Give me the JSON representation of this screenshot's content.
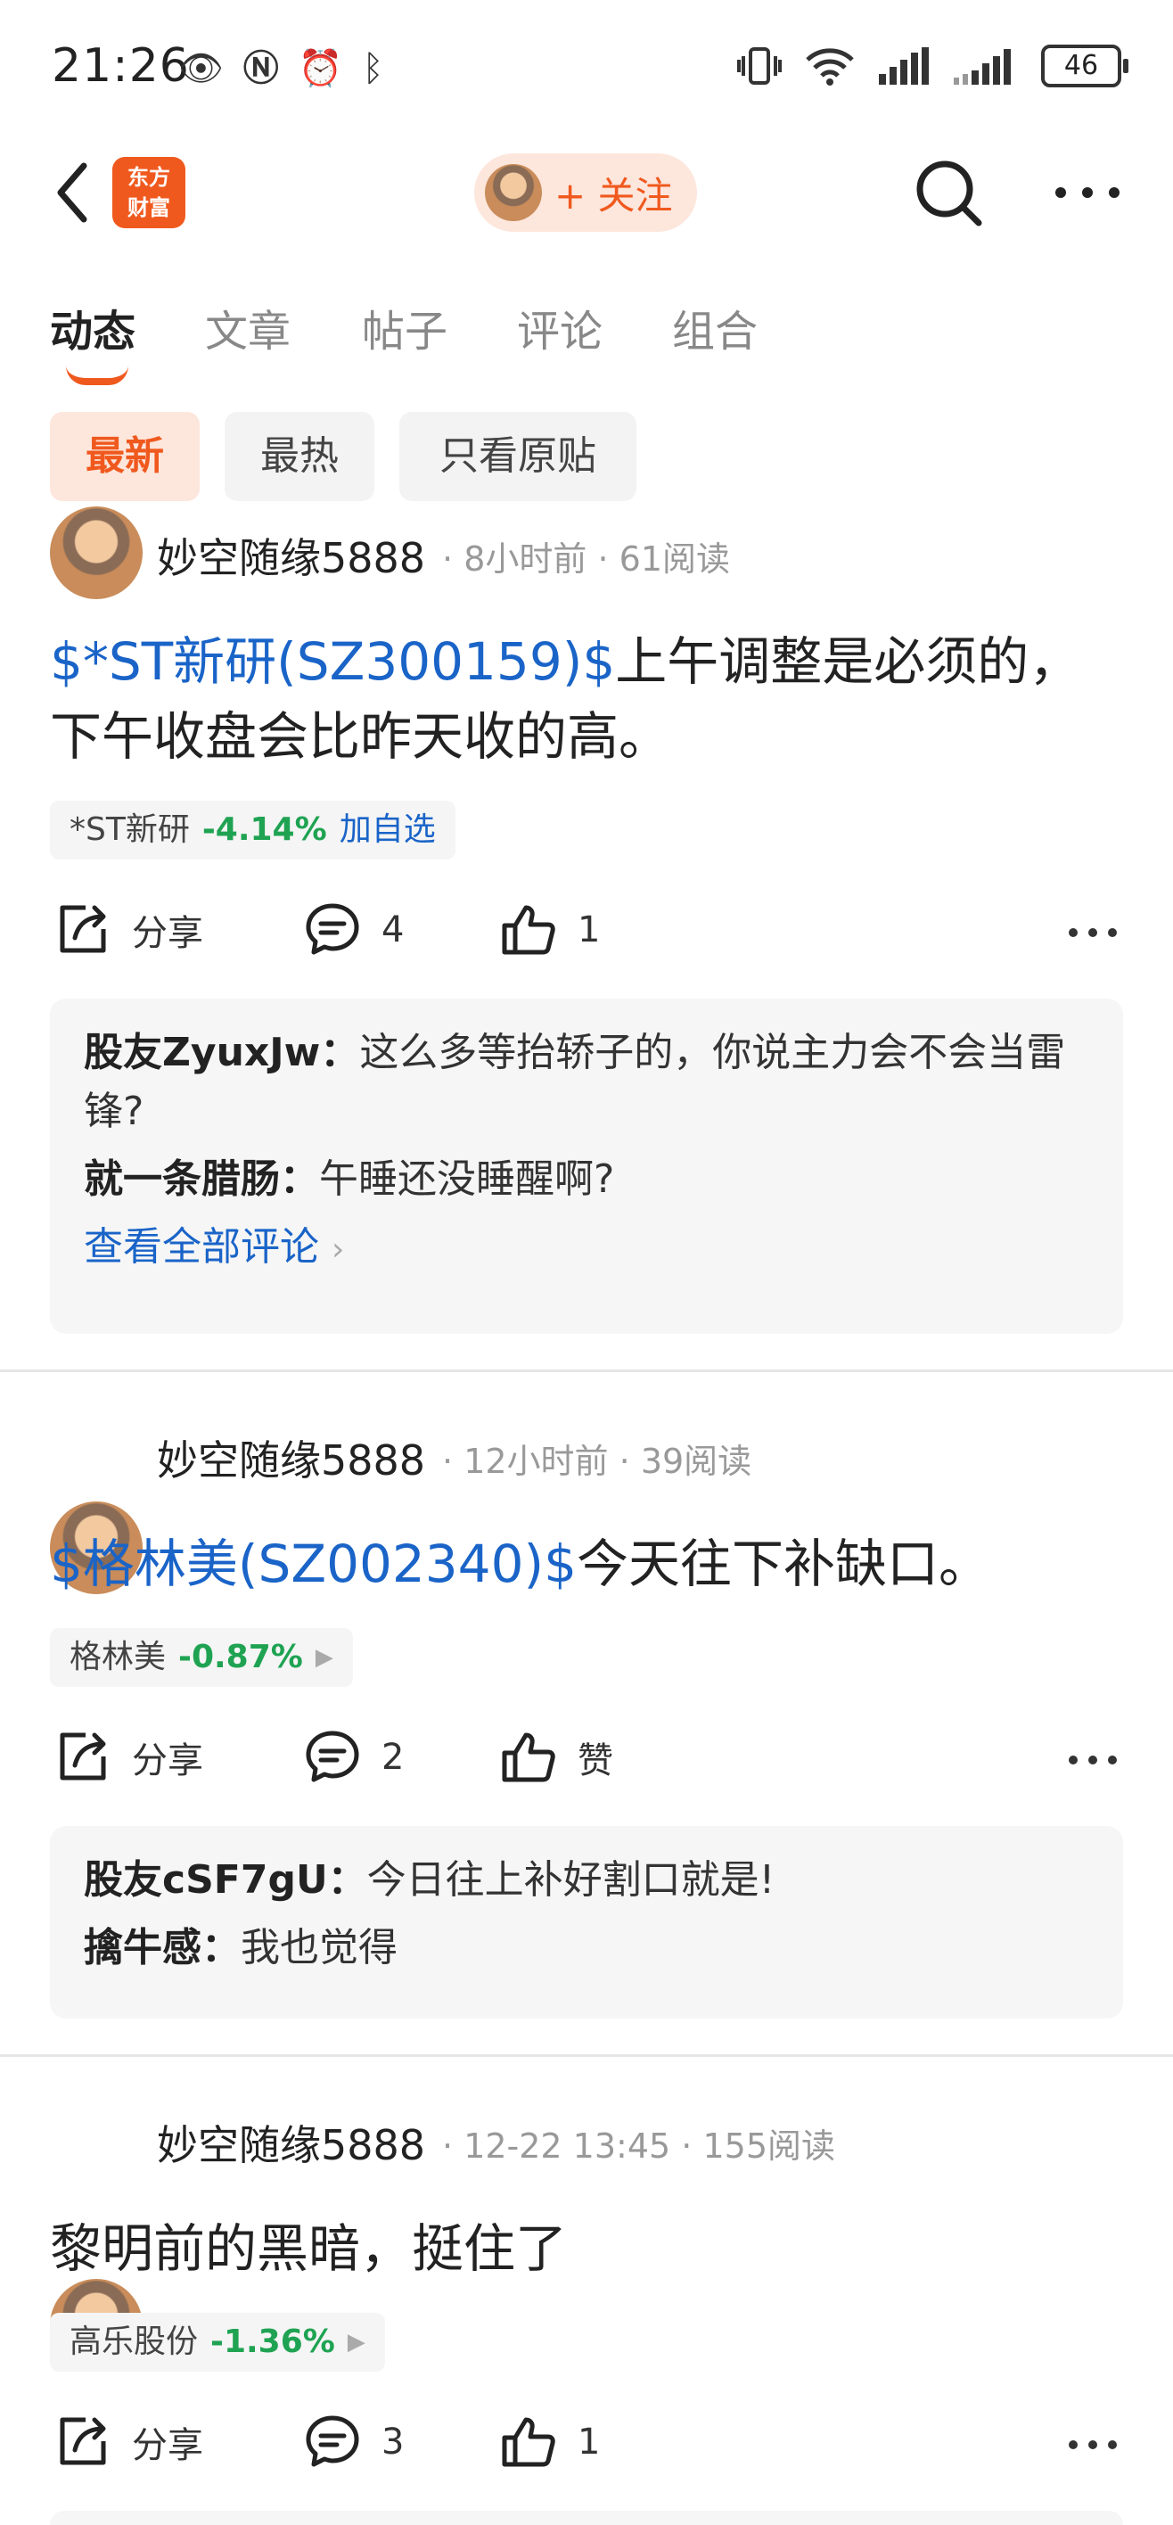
{
  "status_bar": {
    "time": "21:26",
    "battery": "46",
    "left_icons": [
      "eye-icon",
      "nfc-icon",
      "alarm-icon",
      "bluetooth-icon"
    ],
    "right_icons": [
      "vibrate-icon",
      "wifi-icon",
      "signal-icon",
      "signal-icon-2"
    ]
  },
  "header": {
    "logo_text_line1": "东方",
    "logo_text_line2": "财富",
    "follow_label": "+ 关注"
  },
  "tabs": [
    {
      "label": "动态",
      "active": true
    },
    {
      "label": "文章",
      "active": false
    },
    {
      "label": "帖子",
      "active": false
    },
    {
      "label": "评论",
      "active": false
    },
    {
      "label": "组合",
      "active": false
    }
  ],
  "filters": [
    {
      "label": "最新",
      "active": true
    },
    {
      "label": "最热",
      "active": false
    },
    {
      "label": "只看原贴",
      "active": false
    }
  ],
  "actions": {
    "share": "分享"
  },
  "posts": [
    {
      "author": "妙空随缘5888",
      "time": "8小时前",
      "reads": "61阅读",
      "link": "$*ST新研(SZ300159)$",
      "text": "上午调整是必须的，下午收盘会比昨天收的高。",
      "stock_name": "*ST新研",
      "stock_pct": "-4.14%",
      "stock_add": "加自选",
      "comments": "4",
      "likes": "1",
      "replies": [
        {
          "user": "股友ZyuxJw：",
          "text": "这么多等抬轿子的，你说主力会不会当雷锋?"
        },
        {
          "user": "就一条腊肠：",
          "text": "午睡还没睡醒啊?"
        }
      ],
      "view_all": "查看全部评论"
    },
    {
      "author": "妙空随缘5888",
      "time": "12小时前",
      "reads": "39阅读",
      "link": "$格林美(SZ002340)$",
      "text": "今天往下补缺口。",
      "stock_name": "格林美",
      "stock_pct": "-0.87%",
      "comments": "2",
      "likes": "赞",
      "replies": [
        {
          "user": "股友cSF7gU：",
          "text": "今日往上补好割口就是!"
        },
        {
          "user": "擒牛感：",
          "text": "我也觉得"
        }
      ]
    },
    {
      "author": "妙空随缘5888",
      "time": "12-22 13:45",
      "reads": "155阅读",
      "text": "黎明前的黑暗，挺住了",
      "stock_name": "高乐股份",
      "stock_pct": "-1.36%",
      "comments": "3",
      "likes": "1"
    }
  ],
  "meta_sep": "·"
}
